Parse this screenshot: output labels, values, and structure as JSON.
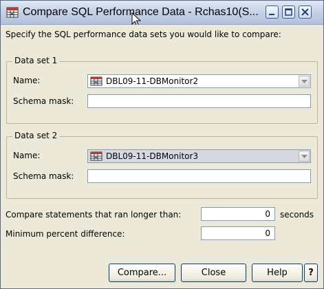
{
  "window": {
    "title": "Compare SQL Performance Data - Rchas10(S...",
    "icon": "database-table-icon"
  },
  "instructions": "Specify the SQL performance data sets you would like to compare:",
  "dataset1": {
    "group_label": "Data set 1",
    "name_label": "Name:",
    "name_value": "DBL09-11-DBMonitor2",
    "schema_label": "Schema mask:",
    "schema_value": ""
  },
  "dataset2": {
    "group_label": "Data set 2",
    "name_label": "Name:",
    "name_value": "DBL09-11-DBMonitor3",
    "schema_label": "Schema mask:",
    "schema_value": ""
  },
  "compare_longer": {
    "label": "Compare statements that ran longer than:",
    "value": "0",
    "unit": "seconds"
  },
  "min_percent": {
    "label": "Minimum percent difference:",
    "value": "0"
  },
  "buttons": {
    "compare": "Compare...",
    "close": "Close",
    "help": "Help",
    "whats_this": "?"
  },
  "colors": {
    "window_bg": "#ece9d8",
    "titlebar": "#c3cfe6",
    "field_border": "#7f9db9",
    "button_border": "#003c74"
  }
}
